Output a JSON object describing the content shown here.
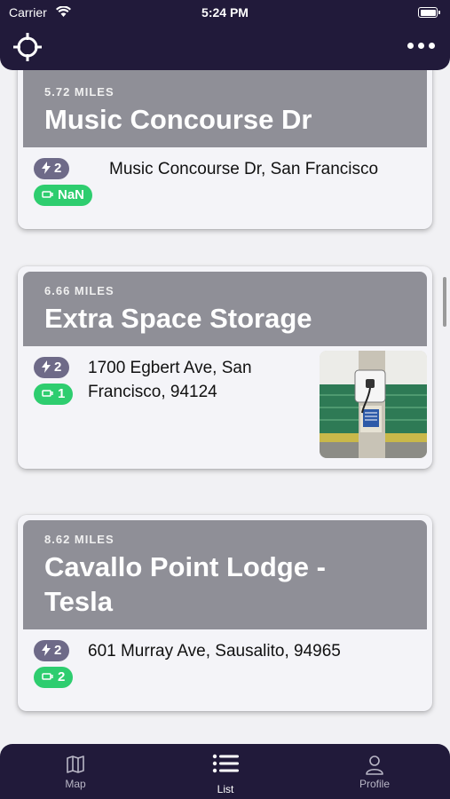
{
  "status_bar": {
    "carrier": "Carrier",
    "time": "5:24 PM"
  },
  "header": {
    "locate_icon": "crosshair-icon",
    "more_icon": "ellipsis-icon"
  },
  "stations": [
    {
      "miles": "5.72 MILES",
      "name": "Music Concourse Dr",
      "ports": "2",
      "free": "NaN",
      "address": "Music Concourse Dr, San Francisco"
    },
    {
      "miles": "6.66 MILES",
      "name": "Extra Space Storage",
      "ports": "2",
      "free": "1",
      "address": "1700 Egbert Ave, San Francisco, 94124",
      "has_photo": true
    },
    {
      "miles": "8.62 MILES",
      "name": "Cavallo Point Lodge - Tesla",
      "ports": "2",
      "free": "2",
      "address": "601 Murray Ave, Sausalito, 94965"
    }
  ],
  "tabs": [
    {
      "label": "Map",
      "icon": "map-icon",
      "active": false
    },
    {
      "label": "List",
      "icon": "list-icon",
      "active": true
    },
    {
      "label": "Profile",
      "icon": "person-icon",
      "active": false
    }
  ],
  "colors": {
    "header_bg": "#211a3a",
    "card_head": "#8f8f97",
    "ports_badge": "#6e6a88",
    "free_badge": "#2ecd6f"
  }
}
